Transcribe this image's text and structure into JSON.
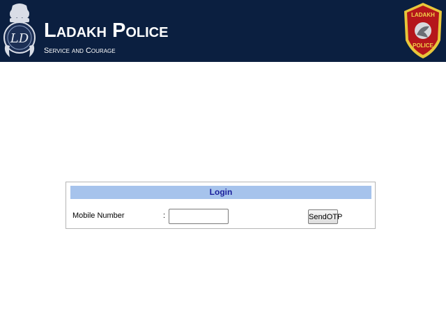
{
  "header": {
    "title": "Ladakh Police",
    "tagline": "Service and Courage",
    "emblem_icon": "state-emblem-icon",
    "emblem_text": "LD",
    "badge_icon": "police-shoulder-badge-icon",
    "badge_text_top": "LADAKH",
    "badge_text_bottom": "POLICE",
    "background_color": "#0b1f40"
  },
  "login": {
    "title": "Login",
    "mobile_label": "Mobile Number",
    "separator": ":",
    "mobile_value": "",
    "mobile_placeholder": "",
    "send_button_label": "SendOTP",
    "title_bar_color": "#a6c3ec",
    "title_text_color": "#1a1f9c"
  }
}
